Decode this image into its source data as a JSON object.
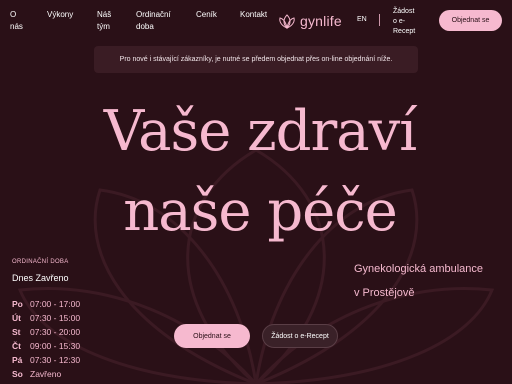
{
  "nav": {
    "items": [
      {
        "label_1": "O",
        "label_2": "nás"
      },
      {
        "label_1": "Výkony",
        "label_2": ""
      },
      {
        "label_1": "Náš",
        "label_2": "tým"
      },
      {
        "label_1": "Ordinační",
        "label_2": "doba"
      },
      {
        "label_1": "Ceník",
        "label_2": ""
      },
      {
        "label_1": "Kontakt",
        "label_2": ""
      }
    ],
    "logo_text": "gynlife",
    "logo_icon": "lotus-icon",
    "language": "EN",
    "erecept_lines": [
      "Žádost",
      "o e-",
      "Recept"
    ],
    "order_button": "Objednat se"
  },
  "notice": "Pro nové i stávající zákazníky, je nutné se předem objednat přes on-line objednání níže.",
  "hero": {
    "title_line_1": "Vaše zdraví",
    "title_line_2": "naše péče",
    "subtitle_line_1": "Gynekologická ambulance",
    "subtitle_line_2": "v Prostějově"
  },
  "hours": {
    "label": "ORDINAČNÍ DOBA",
    "today": "Dnes Zavřeno",
    "rows": [
      {
        "day": "Po",
        "time": "07:00 - 17:00"
      },
      {
        "day": "Út",
        "time": "07:30 - 15:00"
      },
      {
        "day": "St",
        "time": "07:30 - 20:00"
      },
      {
        "day": "Čt",
        "time": "09:00 - 15:30"
      },
      {
        "day": "Pá",
        "time": "07:30 - 12:30"
      },
      {
        "day": "So",
        "time": "Zavřeno"
      }
    ]
  },
  "cta": {
    "order": "Objednat se",
    "erecept": "Žádost o e-Recept"
  },
  "colors": {
    "background": "#2a1017",
    "accent_pink": "#f6b9cf",
    "notice_bg": "#3a1c24"
  }
}
